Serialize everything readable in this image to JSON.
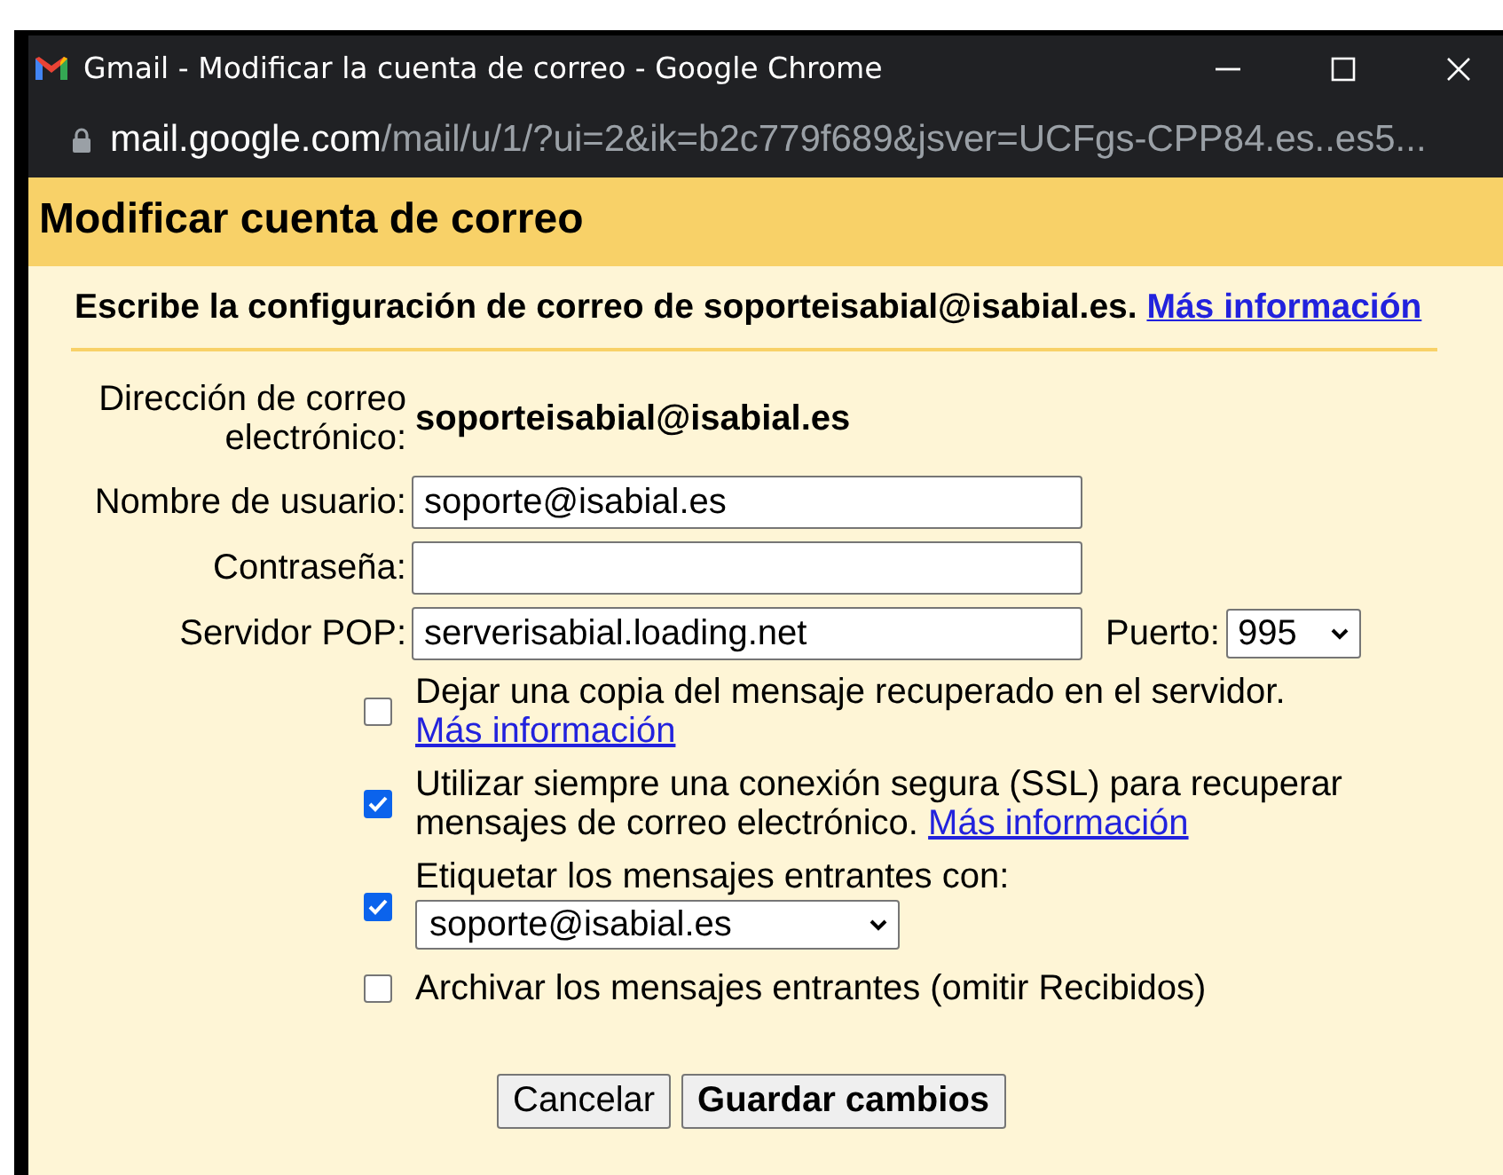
{
  "window": {
    "title": "Gmail - Modificar la cuenta de correo - Google Chrome"
  },
  "address_bar": {
    "host": "mail.google.com",
    "path": "/mail/u/1/?ui=2&ik=b2c779f689&jsver=UCFgs-CPP84.es..es5..."
  },
  "header": {
    "title": "Modificar cuenta de correo"
  },
  "intro": {
    "text": "Escribe la configuración de correo de soporteisabial@isabial.es.",
    "link": "Más información"
  },
  "form": {
    "email_label": "Dirección de correo electrónico:",
    "email_value": "soporteisabial@isabial.es",
    "username": {
      "label": "Nombre de usuario:",
      "value": "soporte@isabial.es"
    },
    "password": {
      "label": "Contraseña:"
    },
    "server": {
      "label": "Servidor POP:",
      "value": "serverisabial.loading.net"
    },
    "port": {
      "label": "Puerto:",
      "value": "995"
    }
  },
  "options": [
    {
      "text": "Dejar una copia del mensaje recuperado en el servidor.",
      "link": "Más información",
      "checked": false
    },
    {
      "text": "Utilizar siempre una conexión segura (SSL) para recuperar mensajes de correo electrónico.",
      "link": "Más información",
      "checked": true
    },
    {
      "text": "Etiquetar los mensajes entrantes con:",
      "select": "soporte@isabial.es",
      "checked": true
    },
    {
      "text": "Archivar los mensajes entrantes (omitir Recibidos)",
      "checked": false
    }
  ],
  "buttons": [
    {
      "label": "Cancelar",
      "kind": "secondary"
    },
    {
      "label": "Guardar cambios",
      "kind": "primary"
    }
  ]
}
